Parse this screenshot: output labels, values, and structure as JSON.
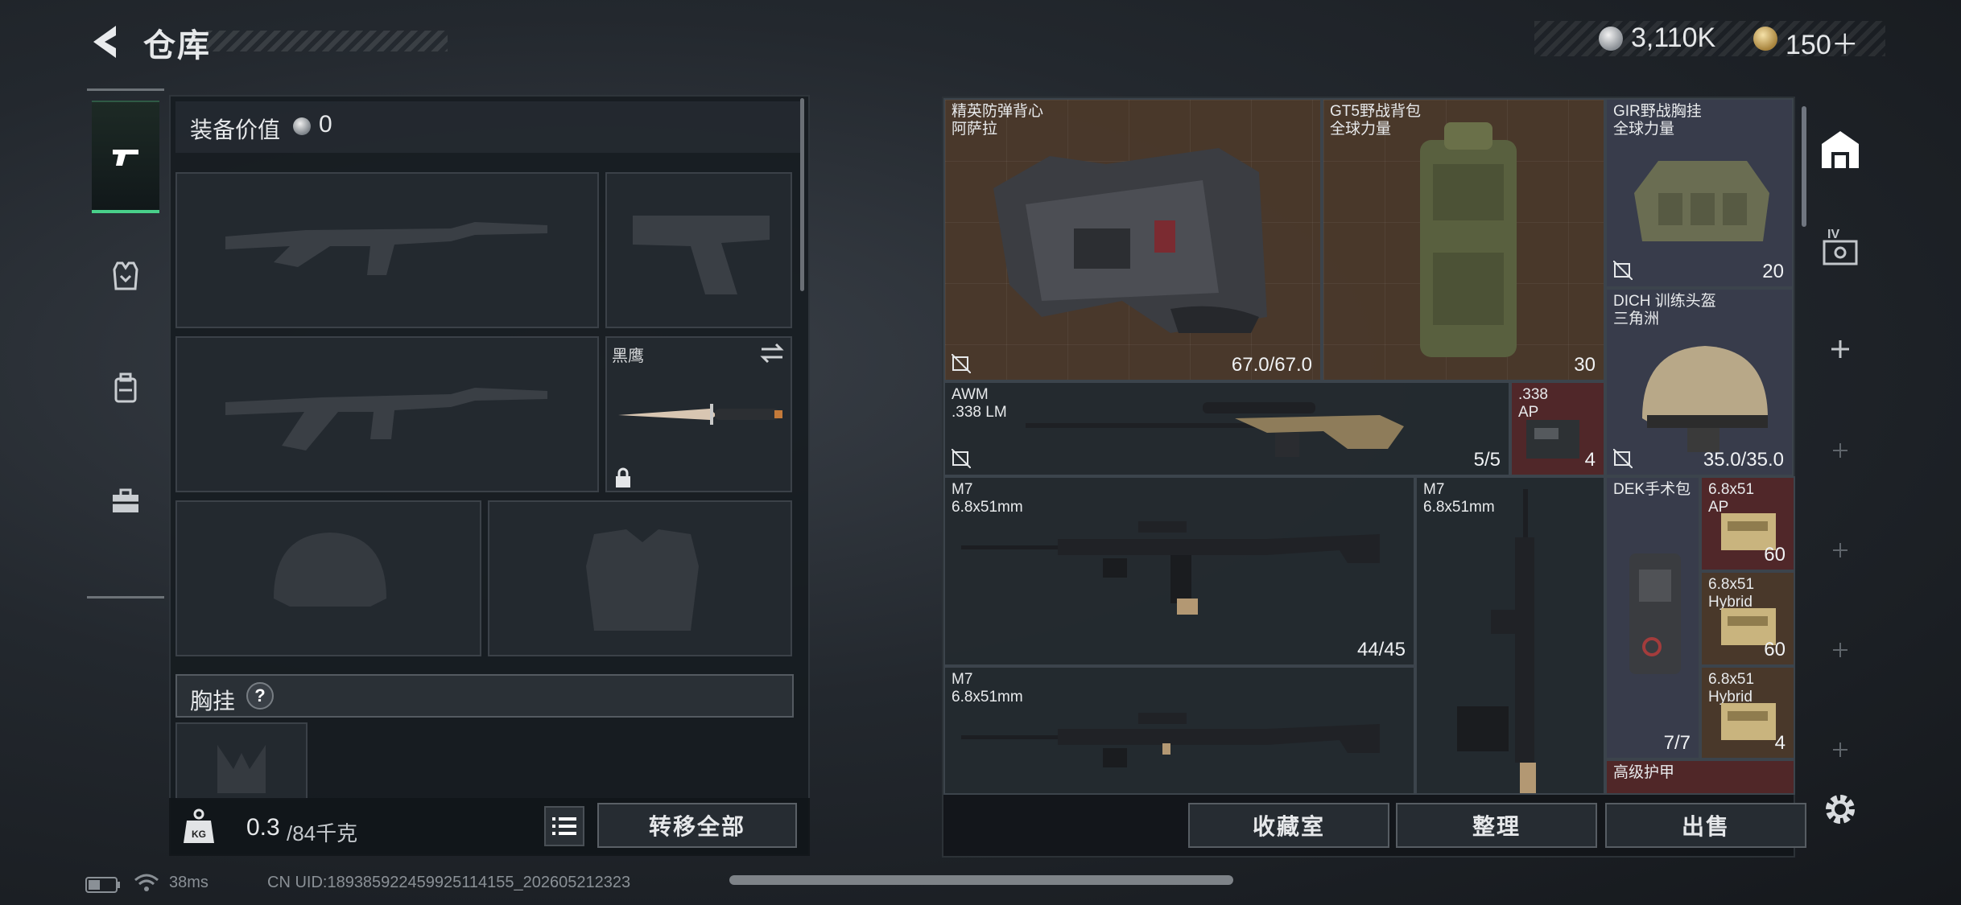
{
  "header": {
    "title": "仓库",
    "currency": {
      "silver": "3,110K",
      "gold": "150＋"
    }
  },
  "left_tabs": [
    "weapons",
    "equipment",
    "backpack",
    "toolbox"
  ],
  "equipment": {
    "value_label": "装备价值",
    "value": "0",
    "melee_name": "黑鹰",
    "chest_label": "胸挂",
    "help": "?",
    "weight_value": "0.3",
    "weight_max": "/84千克",
    "transfer_all": "转移全部"
  },
  "stash": {
    "items": [
      {
        "id": "vest",
        "name": "精英防弹背心\n阿萨拉",
        "count": "67.0/67.0"
      },
      {
        "id": "backpack",
        "name": "GT5野战背包\n全球力量",
        "count": "30"
      },
      {
        "id": "rig",
        "name": "GIR野战胸挂\n全球力量",
        "count": "20"
      },
      {
        "id": "helmet",
        "name": "DICH 训练头盔\n三角洲",
        "count": "35.0/35.0"
      },
      {
        "id": "awm",
        "name": "AWM\n.338 LM",
        "count": "5/5"
      },
      {
        "id": "ammo338",
        "name": ".338\nAP",
        "count": "4"
      },
      {
        "id": "m7a",
        "name": "M7\n6.8x51mm",
        "count": "44/45"
      },
      {
        "id": "m7b",
        "name": "M7\n6.8x51mm",
        "count": ""
      },
      {
        "id": "m7c",
        "name": "M7\n6.8x51mm",
        "count": ""
      },
      {
        "id": "dek",
        "name": "DEK手术包",
        "count": "7/7"
      },
      {
        "id": "ammo_ap",
        "name": "6.8x51\nAP",
        "count": "60"
      },
      {
        "id": "ammo_hybrid1",
        "name": "6.8x51\nHybrid",
        "count": "60"
      },
      {
        "id": "ammo_hybrid2",
        "name": "6.8x51\nHybrid",
        "count": "4"
      },
      {
        "id": "armor_plate",
        "name": "高级护甲",
        "count": ""
      }
    ]
  },
  "buttons": {
    "collection": "收藏室",
    "sort": "整理",
    "sell": "出售"
  },
  "right_sidebar": {
    "label_iv": "IV"
  },
  "status": {
    "ping": "38ms",
    "uid": "CN UID:18938592245992511415​5_202605212323"
  },
  "colors": {
    "accent_green": "#49d08a",
    "gold": "#c9a24e"
  }
}
